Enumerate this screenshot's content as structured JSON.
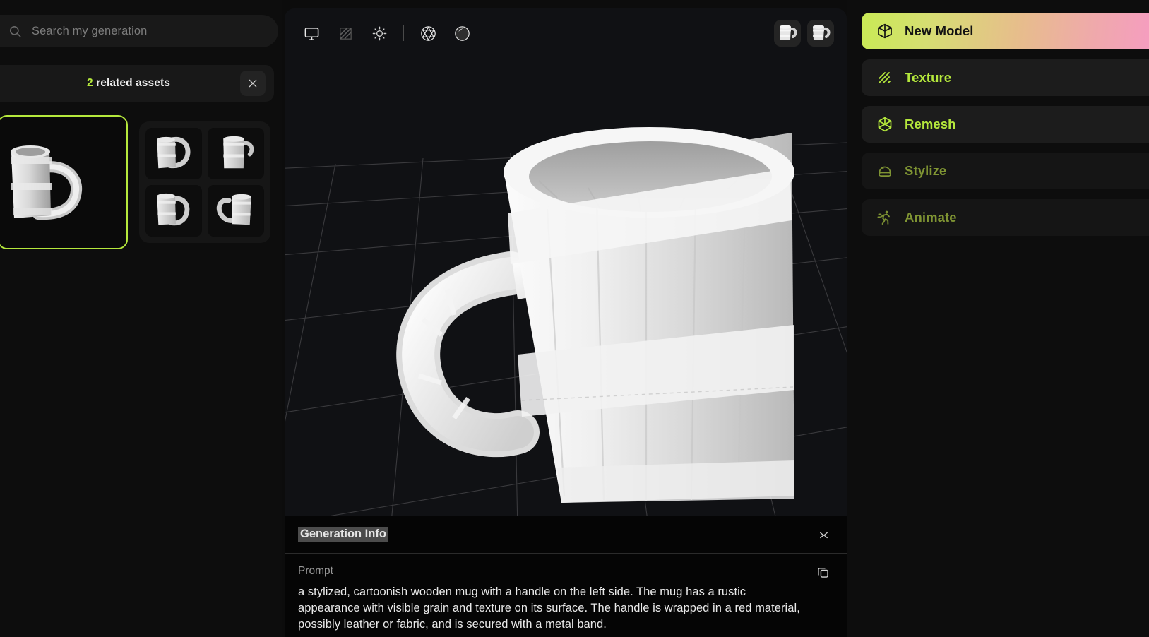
{
  "search": {
    "placeholder": "Search my generation",
    "value": "",
    "icon": "search-icon"
  },
  "related": {
    "count": "2",
    "label_suffix": " related assets",
    "full_label": "2 related assets",
    "close_icon": "close-icon"
  },
  "assets": {
    "hero": {
      "name": "wooden-mug-hero",
      "selected": true,
      "border_color": "#b5e83c"
    },
    "variants": [
      {
        "name": "wooden-mug-variant-1"
      },
      {
        "name": "wooden-mug-variant-2"
      },
      {
        "name": "wooden-mug-variant-3"
      },
      {
        "name": "wooden-mug-variant-4"
      }
    ]
  },
  "viewport": {
    "toolbar": [
      {
        "name": "display-mode-icon",
        "icon": "monitor-icon",
        "active": true
      },
      {
        "name": "texture-toggle-icon",
        "icon": "diagonal-lines-icon",
        "active": false
      },
      {
        "name": "lighting-icon",
        "icon": "sun-icon",
        "active": true
      },
      {
        "name": "divider",
        "icon": "vertical-divider",
        "active": false
      },
      {
        "name": "wireframe-sphere-icon",
        "icon": "wireframe-sphere-icon",
        "active": true
      },
      {
        "name": "shaded-sphere-icon",
        "icon": "shaded-sphere-icon",
        "active": true
      }
    ],
    "thumbs": [
      {
        "name": "viewport-thumb-1"
      },
      {
        "name": "viewport-thumb-2"
      }
    ],
    "background_color": "#101114",
    "grid_color": "#3a3a3d"
  },
  "generation_info": {
    "title": "Generation Info",
    "title_highlighted": true,
    "collapse_icon": "collapse-chevron-icon",
    "prompt_label": "Prompt",
    "copy_icon": "copy-icon",
    "prompt_text": "a stylized, cartoonish wooden mug with a handle on the left side. The mug has a rustic appearance with visible grain and texture on its surface. The handle is wrapped in a red material, possibly leather or fabric, and is secured with a metal band."
  },
  "actions": [
    {
      "label": "New Model",
      "icon": "cube-icon",
      "state": "primary"
    },
    {
      "label": "Texture",
      "icon": "diagonal-lines-icon",
      "state": "normal"
    },
    {
      "label": "Remesh",
      "icon": "polyhedron-icon",
      "state": "normal"
    },
    {
      "label": "Stylize",
      "icon": "crystal-ball-icon",
      "state": "muted"
    },
    {
      "label": "Animate",
      "icon": "running-person-icon",
      "state": "muted"
    }
  ],
  "colors": {
    "accent_green": "#b5e83c",
    "accent_green_muted": "#7f9433",
    "page_background": "#0c0c0c",
    "panel_background": "#1c1c1c",
    "gradient_start": "#c9ea55",
    "gradient_mid": "#e7bd8c",
    "gradient_end": "#f79ac5"
  }
}
